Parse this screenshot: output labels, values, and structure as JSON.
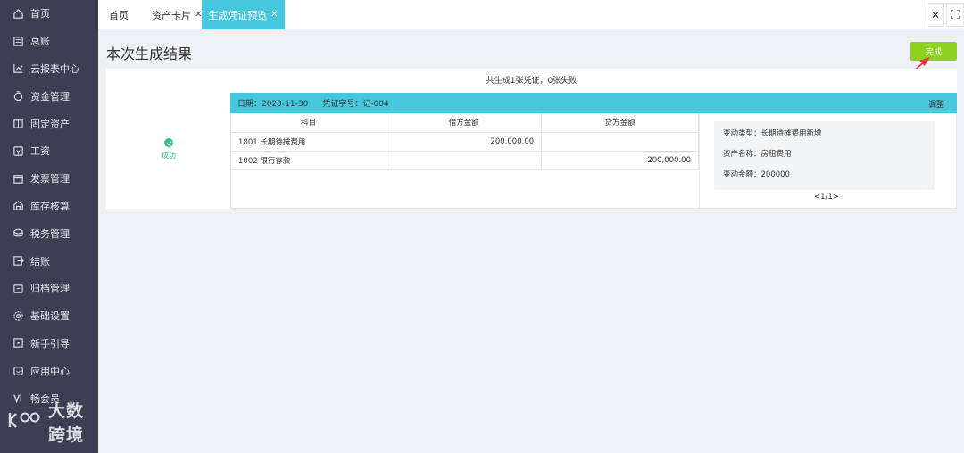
{
  "sidebar": {
    "items": [
      {
        "label": "首页",
        "icon": "home-icon"
      },
      {
        "label": "总账",
        "icon": "ledger-icon"
      },
      {
        "label": "云报表中心",
        "icon": "chart-icon"
      },
      {
        "label": "资金管理",
        "icon": "money-bag-icon"
      },
      {
        "label": "固定资产",
        "icon": "asset-icon"
      },
      {
        "label": "工资",
        "icon": "salary-icon"
      },
      {
        "label": "发票管理",
        "icon": "invoice-icon"
      },
      {
        "label": "库存核算",
        "icon": "warehouse-icon"
      },
      {
        "label": "税务管理",
        "icon": "tax-icon"
      },
      {
        "label": "结账",
        "icon": "checkout-icon"
      },
      {
        "label": "归档管理",
        "icon": "archive-icon"
      },
      {
        "label": "基础设置",
        "icon": "settings-icon"
      },
      {
        "label": "新手引导",
        "icon": "guide-icon"
      },
      {
        "label": "应用中心",
        "icon": "app-center-icon"
      },
      {
        "label": "畅会员",
        "icon": "vip-icon"
      }
    ],
    "logo": "大数跨境"
  },
  "tabs": [
    {
      "label": "首页",
      "closable": false
    },
    {
      "label": "资产卡片",
      "closable": true
    },
    {
      "label": "生成凭证预览",
      "closable": true,
      "active": true
    }
  ],
  "header": {
    "title": "本次生成结果",
    "done_label": "完成"
  },
  "result": {
    "summary": "共生成1张凭证，0张失败",
    "status": "成功"
  },
  "voucher": {
    "date": "日期：2023-11-30",
    "number": "凭证字号：记-004",
    "adjust": "调整",
    "columns": [
      "科目",
      "借方金额",
      "贷方金额"
    ],
    "rows": [
      {
        "subject": "1801 长期待摊费用",
        "debit": "200,000.00",
        "credit": ""
      },
      {
        "subject": "1002 银行存款",
        "debit": "",
        "credit": "200,000.00"
      }
    ]
  },
  "info": {
    "change_type_label": "变动类型：",
    "change_type": "长期待摊费用新增",
    "asset_name_label": "资产名称：",
    "asset_name": "房租费用",
    "amount_label": "变动金额：",
    "amount": "200000"
  },
  "pager": "<1/1>",
  "colors": {
    "sidebar": "#3c3f52",
    "accent": "#45c7de",
    "done": "#8cd21e",
    "success": "#2fc27d",
    "arrow": "#e53935"
  }
}
